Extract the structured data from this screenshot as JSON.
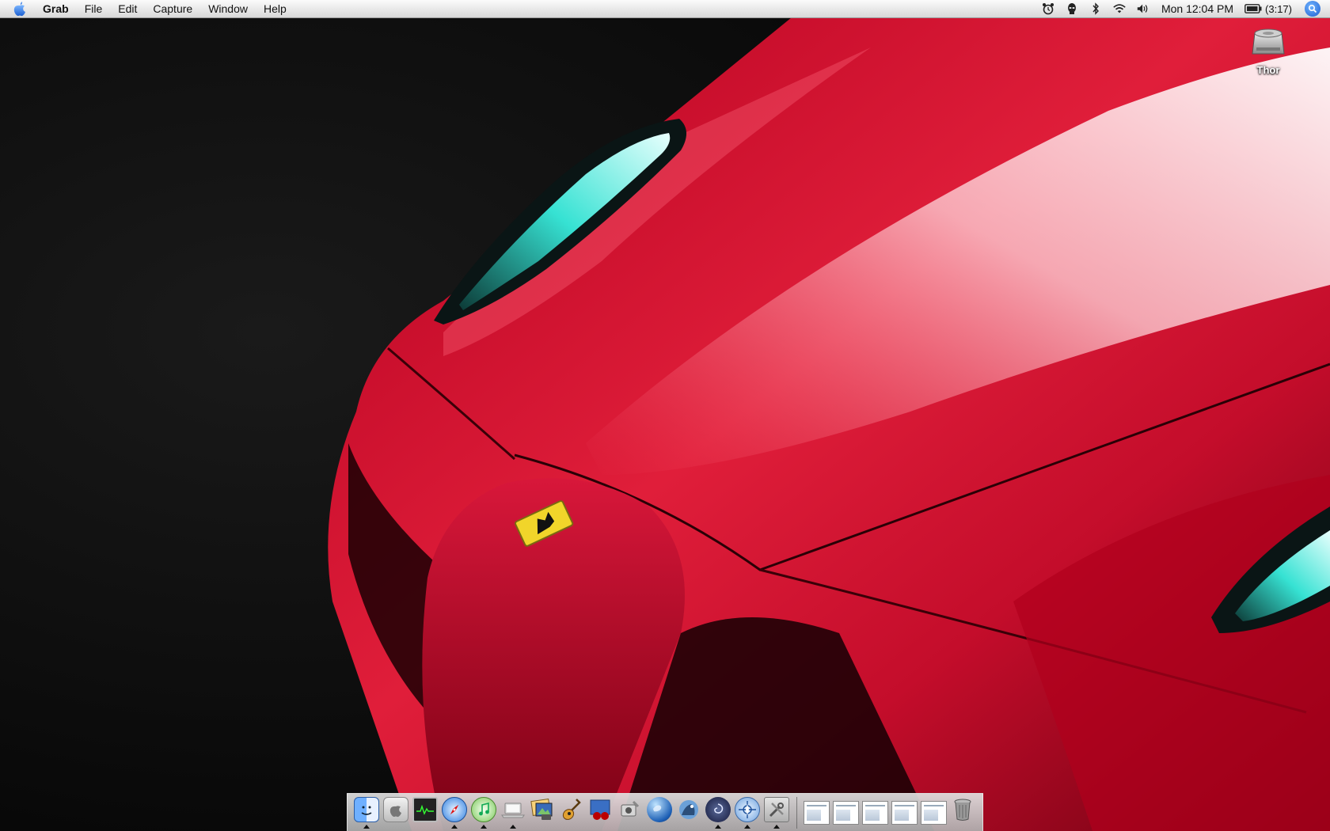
{
  "menubar": {
    "apple_menu": "apple-logo",
    "app_name": "Grab",
    "menus": [
      "File",
      "Edit",
      "Capture",
      "Window",
      "Help"
    ],
    "status_icons": [
      "alarm-clock-icon",
      "alien-icon",
      "bluetooth-icon",
      "wifi-icon",
      "volume-icon"
    ],
    "clock": "Mon 12:04 PM",
    "battery_text": "(3:17)"
  },
  "desktop": {
    "wallpaper": "red-ferrari-enzo",
    "icons": [
      {
        "label": "Thor",
        "icon": "hard-drive-icon"
      }
    ]
  },
  "dock": {
    "apps": [
      {
        "name": "Finder",
        "icon": "finder-icon",
        "running": true
      },
      {
        "name": "System Preferences",
        "icon": "apple-prefs-icon",
        "running": false
      },
      {
        "name": "Activity Monitor",
        "icon": "activity-monitor-icon",
        "running": false
      },
      {
        "name": "Safari",
        "icon": "safari-icon",
        "running": true
      },
      {
        "name": "iTunes",
        "icon": "itunes-icon",
        "running": true
      },
      {
        "name": "Front Row",
        "icon": "laptop-icon",
        "running": true
      },
      {
        "name": "iPhoto",
        "icon": "iphoto-icon",
        "running": false
      },
      {
        "name": "GarageBand",
        "icon": "guitar-icon",
        "running": false
      },
      {
        "name": "Photo Booth",
        "icon": "photo-booth-icon",
        "running": false
      },
      {
        "name": "Grab",
        "icon": "grab-icon",
        "running": false
      },
      {
        "name": "Google Earth",
        "icon": "google-earth-icon",
        "running": false
      },
      {
        "name": "Camino",
        "icon": "camino-icon",
        "running": false
      },
      {
        "name": "Quartz Composer",
        "icon": "swirl-icon",
        "running": true
      },
      {
        "name": "Network Utility",
        "icon": "network-utility-icon",
        "running": true
      },
      {
        "name": "Utilities",
        "icon": "tools-icon",
        "running": true
      }
    ],
    "minimized_windows": 5,
    "trash": "trash-icon"
  },
  "colors": {
    "menubar": "#e8e8e8",
    "car_red": "#c8102e",
    "background": "#050505",
    "headlight": "#4fe0d8"
  }
}
